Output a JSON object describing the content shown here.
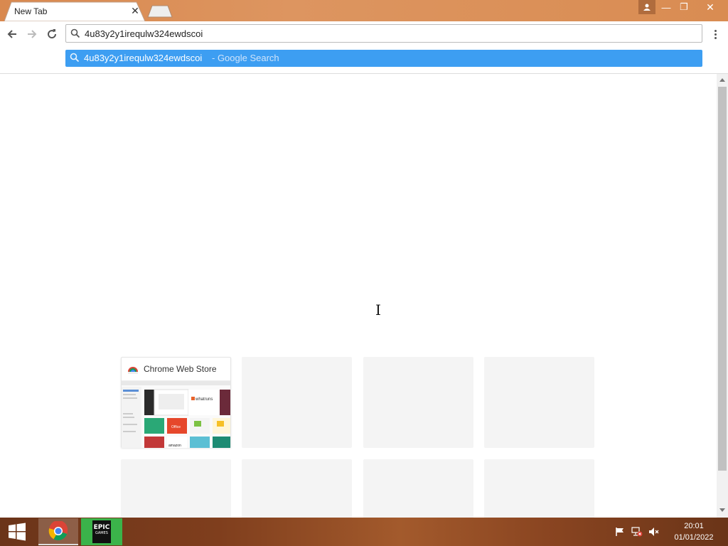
{
  "browser": {
    "tab": {
      "title": "New Tab",
      "close_symbol": "✕"
    },
    "window_controls": {
      "minimize": "—",
      "maximize": "❐",
      "close": "✕"
    },
    "omnibox": {
      "value": "4u83y2y1irequlw324ewdscoi"
    },
    "suggestion": {
      "query": "4u83y2y1irequlw324ewdscoi",
      "suffix": "- Google Search"
    }
  },
  "new_tab_page": {
    "most_visited": [
      {
        "title": "Chrome Web Store"
      }
    ],
    "thumbnail_text": {
      "whatruns": "whatruns",
      "office": "Office",
      "amazon": "amazon"
    }
  },
  "taskbar": {
    "apps": [
      {
        "name": "chrome",
        "icon": "chrome-icon"
      },
      {
        "name": "epic-games",
        "icon": "epic-games-icon",
        "logo_text": "EPIC",
        "logo_subtext": "GAMES"
      }
    ],
    "clock": {
      "time": "20:01",
      "date": "01/01/2022"
    }
  },
  "colors": {
    "titlebar": "#d9894f",
    "suggestion_highlight": "#3d9ef2",
    "epic_tile": "#3bb34a"
  }
}
